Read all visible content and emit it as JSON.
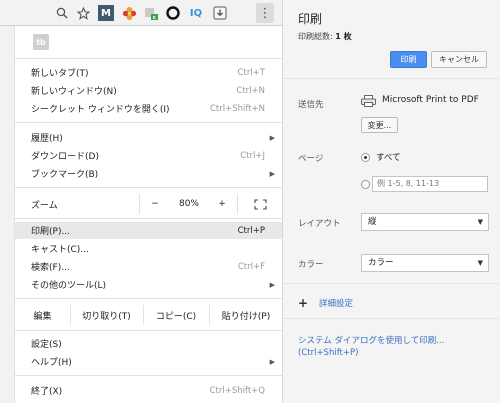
{
  "toolbar": {
    "icons": [
      "zoom-icon",
      "star-icon",
      "m-extension-icon",
      "flower-extension-icon",
      "puzzle-extension-icon",
      "circle-extension-icon",
      "iq-extension-icon",
      "download-extension-icon",
      "menu-icon"
    ],
    "ext_m": "M",
    "ext_iq": "IQ",
    "menu_glyph": "⋮"
  },
  "menu": {
    "ext_tile": "tb",
    "items": [
      {
        "label": "新しいタブ(T)",
        "shortcut": "Ctrl+T"
      },
      {
        "label": "新しいウィンドウ(N)",
        "shortcut": "Ctrl+N"
      },
      {
        "label": "シークレット ウィンドウを開く(I)",
        "shortcut": "Ctrl+Shift+N"
      },
      {
        "label": "履歴(H)",
        "shortcut": "▶"
      },
      {
        "label": "ダウンロード(D)",
        "shortcut": "Ctrl+J"
      },
      {
        "label": "ブックマーク(B)",
        "shortcut": "▶"
      },
      {
        "label": "印刷(P)...",
        "shortcut": "Ctrl+P"
      },
      {
        "label": "キャスト(C)...",
        "shortcut": ""
      },
      {
        "label": "検索(F)...",
        "shortcut": "Ctrl+F"
      },
      {
        "label": "その他のツール(L)",
        "shortcut": "▶"
      },
      {
        "label": "設定(S)",
        "shortcut": ""
      },
      {
        "label": "ヘルプ(H)",
        "shortcut": "▶"
      },
      {
        "label": "終了(X)",
        "shortcut": "Ctrl+Shift+Q"
      }
    ],
    "zoom": {
      "label": "ズーム",
      "minus": "−",
      "value": "80%",
      "plus": "+",
      "fullscreen": "⛶"
    },
    "edit": {
      "label": "編集",
      "cut": "切り取り(T)",
      "copy": "コピー(C)",
      "paste": "貼り付け(P)"
    }
  },
  "print": {
    "title": "印刷",
    "sheets_label": "印刷総数: ",
    "sheets_value": "1 枚",
    "print_button": "印刷",
    "cancel_button": "キャンセル",
    "destination_label": "送信先",
    "destination_name": "Microsoft Print to PDF",
    "change_button": "変更...",
    "pages_label": "ページ",
    "pages_all": "すべて",
    "pages_placeholder": "例 1-5, 8, 11-13",
    "layout_label": "レイアウト",
    "layout_value": "縦",
    "color_label": "カラー",
    "color_value": "カラー",
    "more_settings": "詳細設定",
    "system_dialog": "システム ダイアログを使用して印刷...",
    "system_dialog_shortcut": "(Ctrl+Shift+P)"
  },
  "colors": {
    "print_button": "#4a8ef0",
    "link": "#3a6fc6"
  }
}
